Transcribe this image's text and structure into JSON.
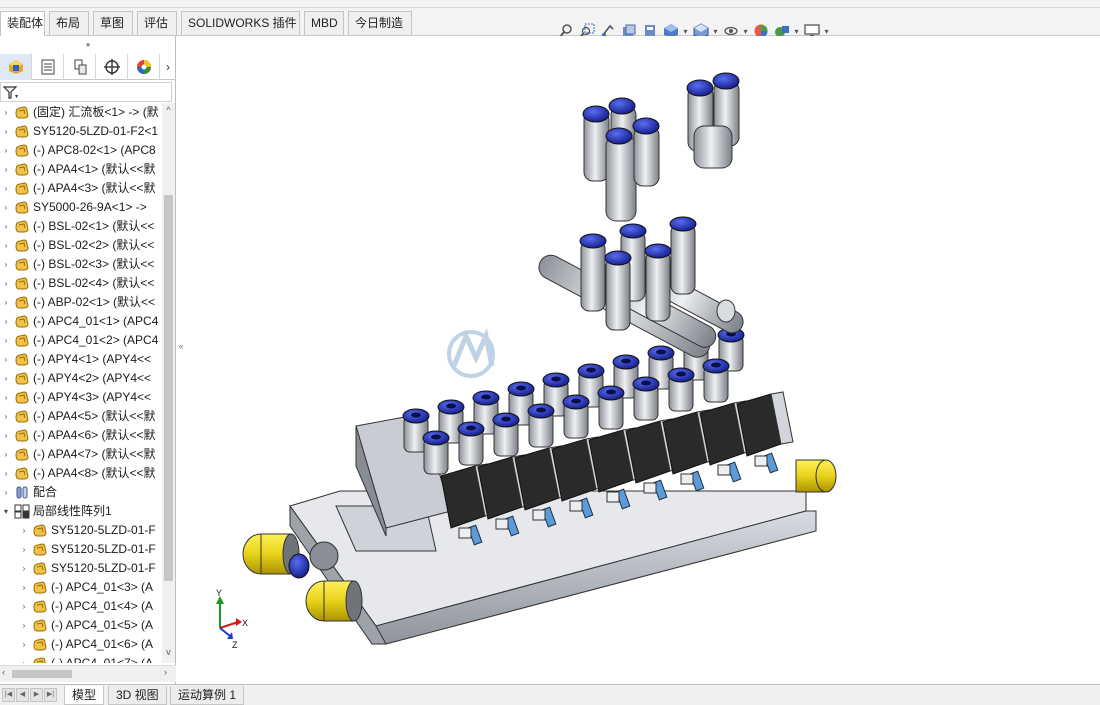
{
  "command_tabs": [
    {
      "label": "装配体",
      "active": true
    },
    {
      "label": "布局"
    },
    {
      "label": "草图"
    },
    {
      "label": "评估"
    },
    {
      "label": "SOLIDWORKS 插件"
    },
    {
      "label": "MBD"
    },
    {
      "label": "今日制造"
    }
  ],
  "heads_up_toolbar": [
    "zoom-to-fit-icon",
    "zoom-to-area-icon",
    "previous-view-icon",
    "section-view-icon",
    "dynamic-annotation-icon",
    "view-orientation-icon",
    "display-style-icon",
    "hide-show-items-icon",
    "edit-appearance-icon",
    "apply-scene-icon",
    "view-settings-icon"
  ],
  "panel_tabs": [
    "featuremanager-tab",
    "propertymanager-tab",
    "configurationmanager-tab",
    "dimxpertmanager-tab",
    "displaymanager-tab"
  ],
  "tree_items": [
    {
      "label": "(固定) 汇流板<1> -> (默",
      "level": 0,
      "icon": "part"
    },
    {
      "label": "SY5120-5LZD-01-F2<1",
      "level": 0,
      "icon": "part"
    },
    {
      "label": "(-) APC8-02<1> (APC8",
      "level": 0,
      "icon": "part"
    },
    {
      "label": "(-) APA4<1> (默认<<默",
      "level": 0,
      "icon": "part"
    },
    {
      "label": "(-) APA4<3> (默认<<默",
      "level": 0,
      "icon": "part"
    },
    {
      "label": "SY5000-26-9A<1> ->",
      "level": 0,
      "icon": "part"
    },
    {
      "label": "(-) BSL-02<1> (默认<<",
      "level": 0,
      "icon": "part"
    },
    {
      "label": "(-) BSL-02<2> (默认<<",
      "level": 0,
      "icon": "part"
    },
    {
      "label": "(-) BSL-02<3> (默认<<",
      "level": 0,
      "icon": "part"
    },
    {
      "label": "(-) BSL-02<4> (默认<<",
      "level": 0,
      "icon": "part"
    },
    {
      "label": "(-) ABP-02<1> (默认<<",
      "level": 0,
      "icon": "part"
    },
    {
      "label": "(-) APC4_01<1> (APC4",
      "level": 0,
      "icon": "part"
    },
    {
      "label": "(-) APC4_01<2> (APC4",
      "level": 0,
      "icon": "part"
    },
    {
      "label": "(-) APY4<1> (APY4<<",
      "level": 0,
      "icon": "part"
    },
    {
      "label": "(-) APY4<2> (APY4<<",
      "level": 0,
      "icon": "part"
    },
    {
      "label": "(-) APY4<3> (APY4<<",
      "level": 0,
      "icon": "part"
    },
    {
      "label": "(-) APA4<5> (默认<<默",
      "level": 0,
      "icon": "part"
    },
    {
      "label": "(-) APA4<6> (默认<<默",
      "level": 0,
      "icon": "part"
    },
    {
      "label": "(-) APA4<7> (默认<<默",
      "level": 0,
      "icon": "part"
    },
    {
      "label": "(-) APA4<8> (默认<<默",
      "level": 0,
      "icon": "part"
    },
    {
      "label": "配合",
      "level": 0,
      "icon": "mates"
    },
    {
      "label": "局部线性阵列1",
      "level": 0,
      "icon": "pattern",
      "expanded": true
    },
    {
      "label": "SY5120-5LZD-01-F",
      "level": 1,
      "icon": "part"
    },
    {
      "label": "SY5120-5LZD-01-F",
      "level": 1,
      "icon": "part"
    },
    {
      "label": "SY5120-5LZD-01-F",
      "level": 1,
      "icon": "part"
    },
    {
      "label": "(-) APC4_01<3> (A",
      "level": 1,
      "icon": "part"
    },
    {
      "label": "(-) APC4_01<4> (A",
      "level": 1,
      "icon": "part"
    },
    {
      "label": "(-) APC4_01<5> (A",
      "level": 1,
      "icon": "part"
    },
    {
      "label": "(-) APC4_01<6> (A",
      "level": 1,
      "icon": "part"
    },
    {
      "label": "(-) APC4_01<7> (A",
      "level": 1,
      "icon": "part"
    }
  ],
  "triad": {
    "x": "X",
    "y": "Y",
    "z": "Z"
  },
  "bottom_tabs": [
    {
      "label": "模型",
      "active": true
    },
    {
      "label": "3D 视图"
    },
    {
      "label": "运动算例 1"
    }
  ],
  "colors": {
    "blue_cap": "#1c2fb4",
    "yellow_plug": "#e8d21a",
    "body_gray": "#b8bcc4",
    "solenoid": "#2a2a2a",
    "tab_active_bg": "#ffffff",
    "panel_tab_active": "#dfe8f4"
  }
}
